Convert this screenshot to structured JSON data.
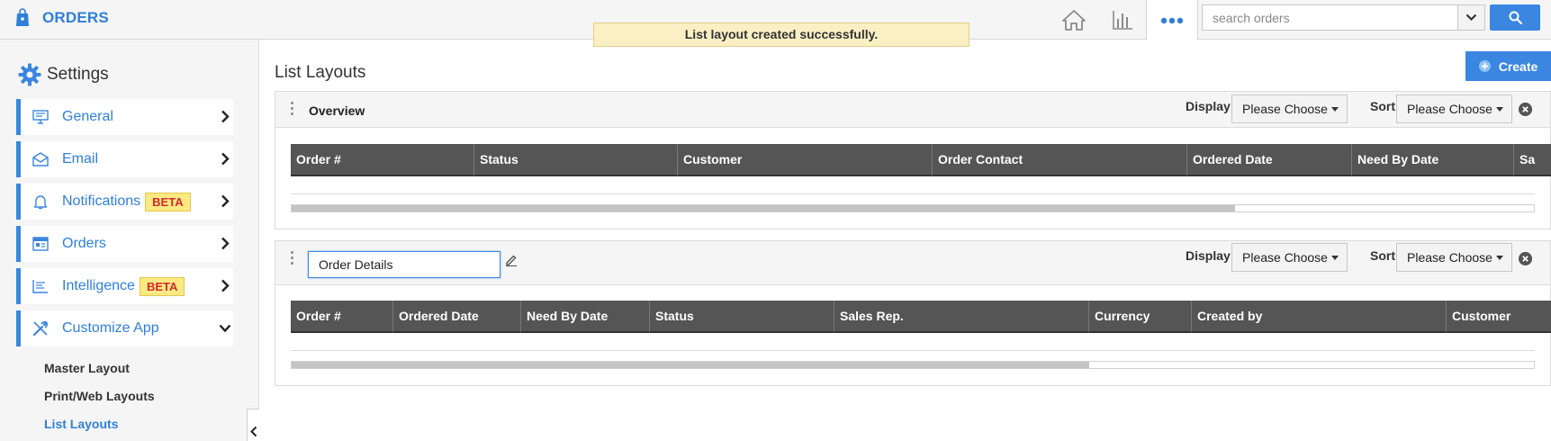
{
  "app": {
    "title": "ORDERS"
  },
  "toast": {
    "message": "List layout created successfully."
  },
  "search": {
    "placeholder": "search orders"
  },
  "sidebar": {
    "title": "Settings",
    "items": [
      {
        "label": "General",
        "icon": "monitor-icon",
        "beta": ""
      },
      {
        "label": "Email",
        "icon": "envelope-icon",
        "beta": ""
      },
      {
        "label": "Notifications",
        "icon": "bell-icon",
        "beta": "BETA"
      },
      {
        "label": "Orders",
        "icon": "orders-icon",
        "beta": ""
      },
      {
        "label": "Intelligence",
        "icon": "report-icon",
        "beta": "BETA"
      },
      {
        "label": "Customize App",
        "icon": "tools-icon",
        "beta": ""
      }
    ],
    "sub_items": [
      "Master Layout",
      "Print/Web Layouts",
      "List Layouts"
    ]
  },
  "main": {
    "title": "List Layouts",
    "create_label": "Create",
    "display_label": "Display",
    "sort_label": "Sort",
    "select_placeholder": "Please Choose",
    "layouts": [
      {
        "name": "Overview",
        "columns": [
          "Order #",
          "Status",
          "Customer",
          "Order Contact",
          "Ordered Date",
          "Need By Date",
          "Sa"
        ]
      },
      {
        "name": "Order Details",
        "columns": [
          "Order #",
          "Ordered Date",
          "Need By Date",
          "Status",
          "Sales Rep.",
          "Currency",
          "Created by",
          "Customer"
        ]
      }
    ]
  },
  "colors": {
    "accent": "#3a86e0",
    "header_dark": "#555555",
    "toast_bg": "#fbefc4",
    "beta_bg": "#fbe983"
  }
}
